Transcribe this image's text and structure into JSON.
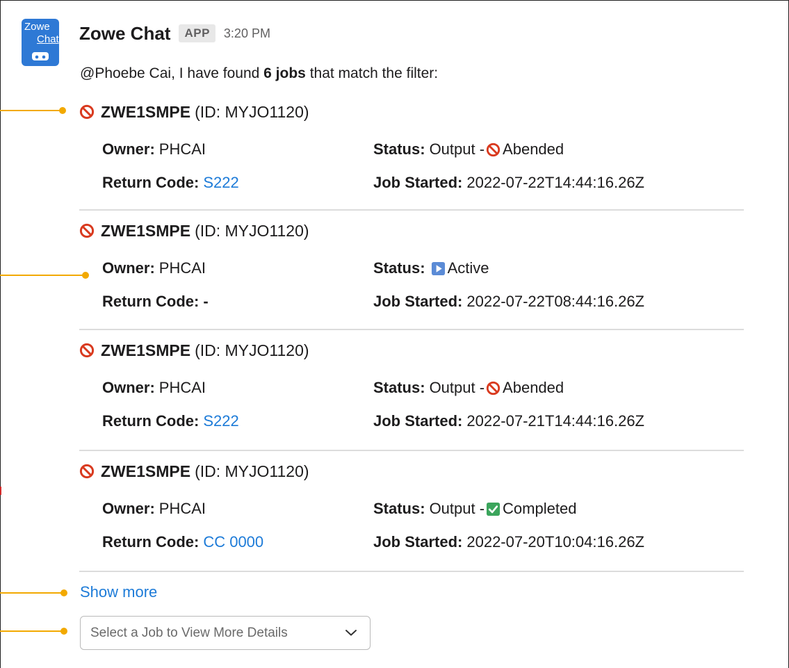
{
  "message": {
    "avatar": {
      "line1": "Zowe",
      "line2": "Chat",
      "icon": "robot-icon"
    },
    "sender": "Zowe Chat",
    "badge": "APP",
    "time": "3:20 PM",
    "intro": {
      "prefix": "@Phoebe Cai, I have found ",
      "bold": "6 jobs",
      "suffix": " that match the filter:"
    }
  },
  "labels": {
    "owner": "Owner:",
    "status": "Status:",
    "return_code": "Return Code:",
    "job_started": "Job Started:"
  },
  "jobs": [
    {
      "name": "ZWE1SMPE",
      "id_text": "(ID: MYJO1120)",
      "owner": "PHCAI",
      "status_prefix": "Output - ",
      "status_icon": "prohibited-icon",
      "status_text": "Abended",
      "return_code": "S222",
      "return_code_link": true,
      "started": "2022-07-22T14:44:16.26Z"
    },
    {
      "name": "ZWE1SMPE",
      "id_text": "(ID: MYJO1120)",
      "owner": "PHCAI",
      "status_prefix": "",
      "status_icon": "play-icon",
      "status_text": "Active",
      "return_code": "-",
      "return_code_link": false,
      "started": "2022-07-22T08:44:16.26Z"
    },
    {
      "name": "ZWE1SMPE",
      "id_text": "(ID: MYJO1120)",
      "owner": "PHCAI",
      "status_prefix": "Output - ",
      "status_icon": "prohibited-icon",
      "status_text": "Abended",
      "return_code": "S222",
      "return_code_link": true,
      "started": "2022-07-21T14:44:16.26Z"
    },
    {
      "name": "ZWE1SMPE",
      "id_text": "(ID: MYJO1120)",
      "owner": "PHCAI",
      "status_prefix": "Output - ",
      "status_icon": "check-icon",
      "status_text": "Completed",
      "return_code": "CC 0000",
      "return_code_link": true,
      "started": "2022-07-20T10:04:16.26Z"
    }
  ],
  "show_more": "Show more",
  "job_select": {
    "placeholder": "Select a Job to View More Details",
    "icon": "chevron-down-icon"
  },
  "colors": {
    "link": "#1d7bd8",
    "avatar": "#2e79d5",
    "callout": "#f2a900",
    "prohibited": "#d93a1f",
    "check": "#3ba55c",
    "play": "#5b8bd6"
  }
}
